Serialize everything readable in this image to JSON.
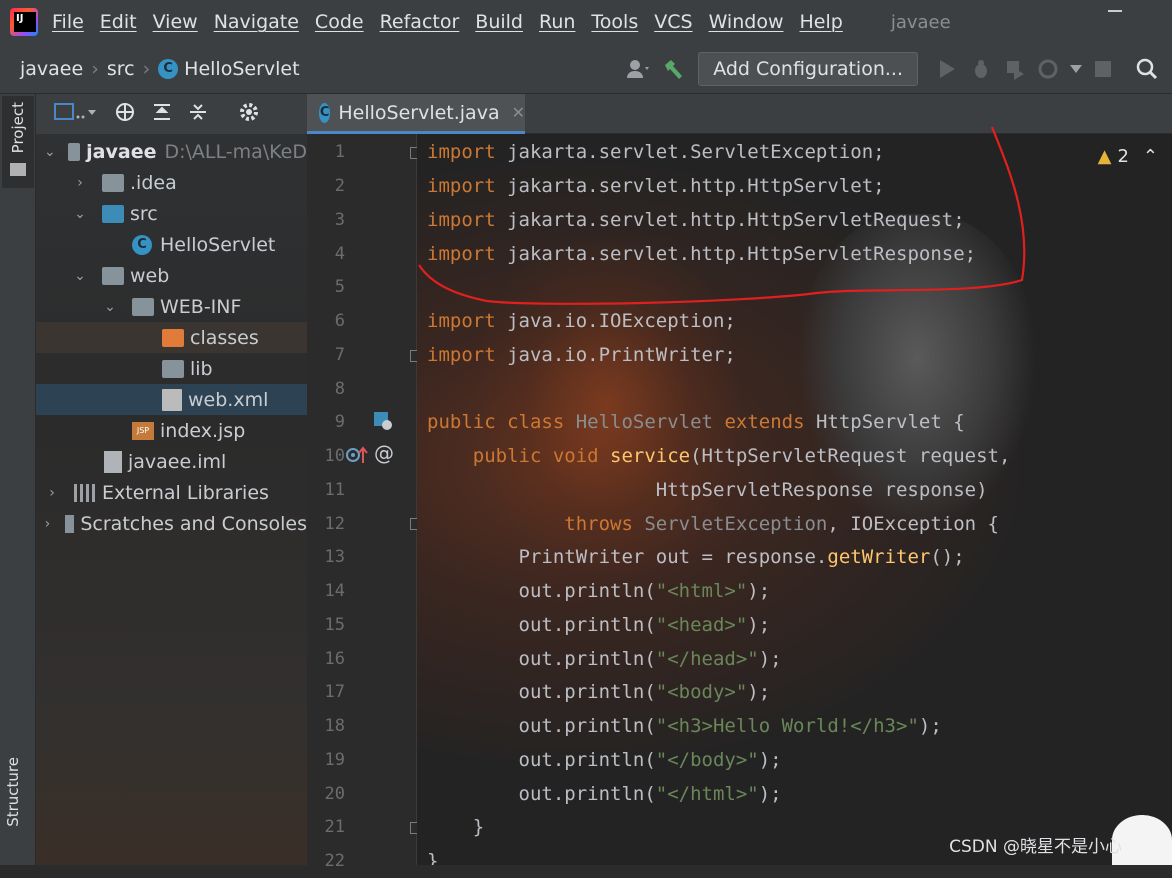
{
  "menubar": {
    "items": [
      "File",
      "Edit",
      "View",
      "Navigate",
      "Code",
      "Refactor",
      "Build",
      "Run",
      "Tools",
      "VCS",
      "Window",
      "Help"
    ],
    "project_title": "javaee"
  },
  "navbar": {
    "crumbs": [
      "javaee",
      "src",
      "HelloServlet"
    ],
    "add_configuration": "Add Configuration..."
  },
  "sidebar": {
    "project_label": "Project",
    "structure_label": "Structure"
  },
  "tree": {
    "root_name": "javaee",
    "root_path": "D:\\ALL-ma\\KeD",
    "idea": ".idea",
    "src": "src",
    "hello": "HelloServlet",
    "web": "web",
    "webinf": "WEB-INF",
    "classes": "classes",
    "lib": "lib",
    "webxml": "web.xml",
    "indexjsp": "index.jsp",
    "iml": "javaee.iml",
    "extlibs": "External Libraries",
    "scratches": "Scratches and Consoles"
  },
  "tab": {
    "label": "HelloServlet.java"
  },
  "inspection": {
    "warnings": "2"
  },
  "code": {
    "line_numbers": [
      "1",
      "2",
      "3",
      "4",
      "5",
      "6",
      "7",
      "8",
      "9",
      "10",
      "11",
      "12",
      "13",
      "14",
      "15",
      "16",
      "17",
      "18",
      "19",
      "20",
      "21",
      "22"
    ],
    "l1": [
      "import",
      " jakarta.servlet.ServletException;"
    ],
    "l2": [
      "import",
      " jakarta.servlet.http.HttpServlet;"
    ],
    "l3": [
      "import",
      " jakarta.servlet.http.HttpServletRequest;"
    ],
    "l4": [
      "import",
      " jakarta.servlet.http.HttpServletResponse;"
    ],
    "l6": [
      "import",
      " java.io.IOException;"
    ],
    "l7": [
      "import",
      " java.io.PrintWriter;"
    ],
    "l9": [
      "public class ",
      "HelloServlet",
      " extends ",
      "HttpServlet {"
    ],
    "l10": [
      "    public void ",
      "service",
      "(HttpServletRequest request,"
    ],
    "l11": [
      "                    HttpServletResponse response)"
    ],
    "l12": [
      "            throws ",
      "ServletException",
      ", IOException {"
    ],
    "l13": [
      "        PrintWriter out = response.",
      "getWriter",
      "();"
    ],
    "l14": [
      "        out.println(",
      "\"<html>\"",
      ");"
    ],
    "l15": [
      "        out.println(",
      "\"<head>\"",
      ");"
    ],
    "l16": [
      "        out.println(",
      "\"</head>\"",
      ");"
    ],
    "l17": [
      "        out.println(",
      "\"<body>\"",
      ");"
    ],
    "l18": [
      "        out.println(",
      "\"<h3>Hello World!</h3>\"",
      ");"
    ],
    "l19": [
      "        out.println(",
      "\"</body>\"",
      ");"
    ],
    "l20": [
      "        out.println(",
      "\"</html>\"",
      ");"
    ],
    "l21": [
      "    }"
    ],
    "l22": [
      "}"
    ]
  },
  "watermark": "CSDN @晓星不是小心"
}
